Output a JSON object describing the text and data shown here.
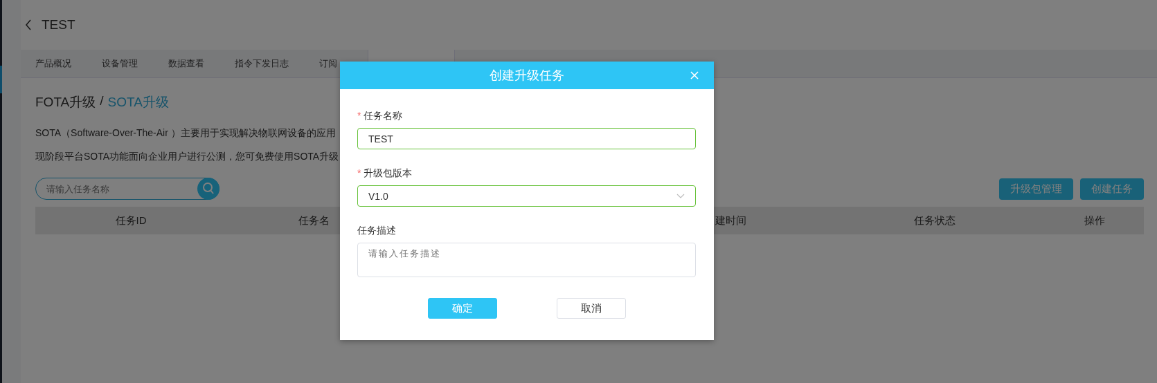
{
  "header": {
    "title": "TEST"
  },
  "tabs": [
    {
      "label": "产品概况",
      "selected": false
    },
    {
      "label": "设备管理",
      "selected": false
    },
    {
      "label": "数据查看",
      "selected": false
    },
    {
      "label": "指令下发日志",
      "selected": false
    },
    {
      "label": "订阅",
      "selected": false
    },
    {
      "selected": true
    }
  ],
  "breadcrumb": {
    "items": [
      {
        "label": "FOTA升级",
        "selected": false
      },
      {
        "label": "SOTA升级",
        "selected": true
      }
    ],
    "separator": "/"
  },
  "description": [
    "SOTA（Software-Over-The-Air ）主要用于实现解决物联网设备的应用",
    "现阶段平台SOTA功能面向企业用户进行公测，您可免费使用SOTA升级"
  ],
  "search": {
    "placeholder": "请输入任务名称"
  },
  "actions": [
    "升级包管理",
    "创建任务"
  ],
  "table": {
    "columns": [
      "任务ID",
      "任务名",
      "建时间",
      "任务状态",
      "操作"
    ]
  },
  "dialog": {
    "title": "创建升级任务",
    "required_mark": "*",
    "fields": [
      {
        "kind": "input",
        "label": "任务名称",
        "required": true,
        "value": "TEST",
        "valid": true
      },
      {
        "kind": "select",
        "label": "升级包版本",
        "required": true,
        "value": "V1.0",
        "valid": true
      },
      {
        "kind": "textarea",
        "label": "任务描述",
        "required": false,
        "placeholder": "请输入任务描述"
      }
    ],
    "buttons": [
      {
        "label": "确定",
        "primary": true
      },
      {
        "label": "取消",
        "primary": false
      }
    ]
  }
}
